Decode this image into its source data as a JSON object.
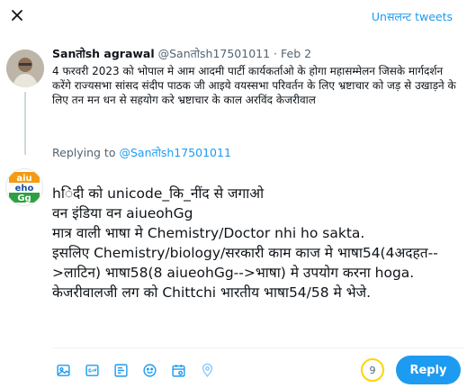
{
  "header": {
    "unsent_label": "Unसलन्ट tweets"
  },
  "tweet": {
    "author_name": "Sanतोsh agrawal",
    "author_handle": "@Sanतोsh17501011",
    "date_sep": "·",
    "date": "Feb 2",
    "body": "4 फरवरी 2023 को भोपाल मे आम आदमी पार्टी कार्यकर्ताओ के होगा महासम्मेलन जिसके मार्गदर्शन करेंगे राज्यसभा सांसद संदीप पाठक जी आइये वयस्सभा परिवर्तन के लिए भ्रष्टाचार को जड़ से उखाड़ने के लिए तन मन धन से सहयोग करे भ्रष्टाचार के काल अरविंद केजरीवाल",
    "replying_label": "Replying to",
    "replying_handle": "@Sanतोsh17501011"
  },
  "me_avatar": {
    "line1": "aiu",
    "line2": "eho",
    "line3": "Gg"
  },
  "compose": {
    "lines": [
      "hिंदी को unicode_कि_नींद से जगाओ",
      "वन इंडिया वन aiueohGg",
      "मात्र वाली भाषा मे Chemistry/Doctor nhi ho sakta.",
      "इसलिए Chemistry/biology/सरकारी काम काज मे भाषा54(4अदहत-->लाटिन) भाषा58(8 aiueohGg-->भाषा) मे उपयोग करना hoga. केजरीवालजी लग को Chittchi भारतीय भाषा54/58 मे भेजे."
    ]
  },
  "toolbar": {
    "icons": [
      "image-icon",
      "gif-icon",
      "poll-icon",
      "emoji-icon",
      "schedule-icon",
      "location-icon"
    ],
    "char_counter": "9",
    "reply_label": "Reply"
  },
  "colors": {
    "accent": "#1d9bf0",
    "counter_ring": "#ffd400",
    "muted": "#536471"
  }
}
